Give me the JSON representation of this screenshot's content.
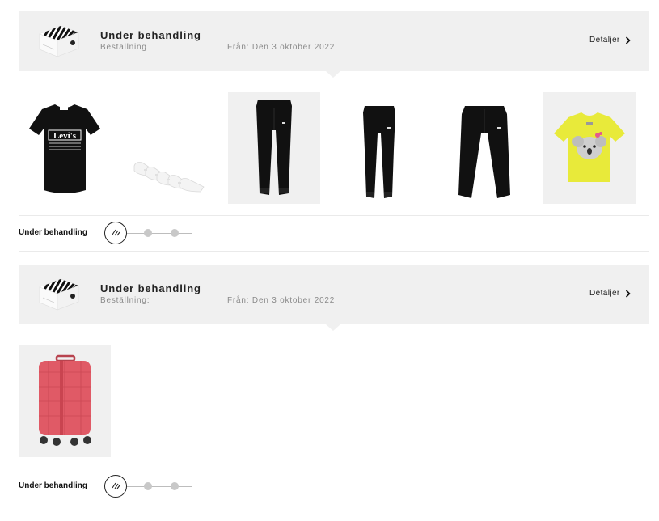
{
  "orders": [
    {
      "status_title": "Under behandling",
      "order_label": "Beställning",
      "date_text": "Från: Den 3 oktober 2022",
      "details_label": "Detaljer",
      "progress_label": "Under behandling",
      "products": [
        {
          "name": "black-levis-tshirt"
        },
        {
          "name": "white-socks-pack"
        },
        {
          "name": "black-track-pants"
        },
        {
          "name": "black-joggers"
        },
        {
          "name": "black-capri-sweatpants"
        },
        {
          "name": "yellow-koala-tshirt"
        }
      ]
    },
    {
      "status_title": "Under behandling",
      "order_label": "Beställning:",
      "date_text": "Från: Den 3 oktober 2022",
      "details_label": "Detaljer",
      "progress_label": "Under behandling",
      "products": [
        {
          "name": "red-suitcase"
        }
      ]
    }
  ],
  "colors": {
    "header_bg": "#f0f0f0",
    "muted_text": "#8a8a8a",
    "progress_inactive": "#c8c8c8",
    "suitcase_red": "#e05a66",
    "tshirt_yellow": "#e8ea3a"
  },
  "progress": {
    "current_step": 1,
    "total_steps": 3
  }
}
